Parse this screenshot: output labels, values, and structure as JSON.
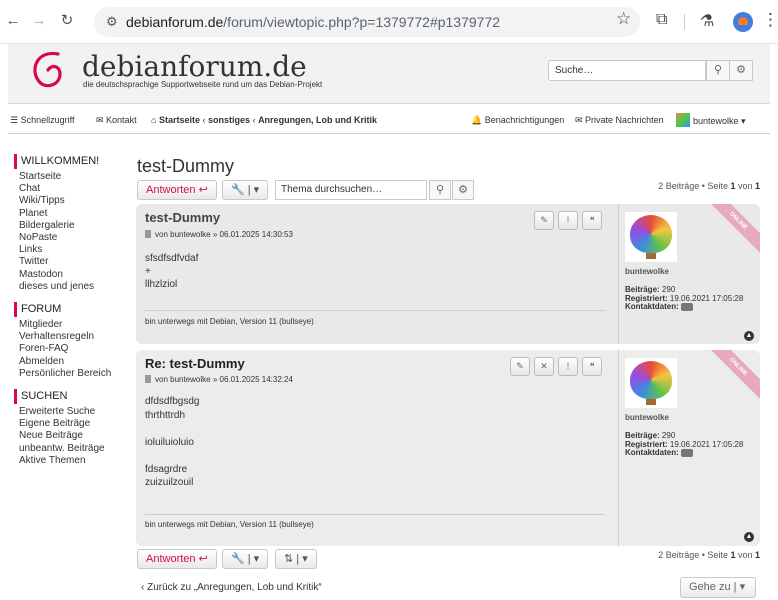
{
  "browser": {
    "url_domain": "debianforum.de",
    "url_path": "/forum/viewtopic.php?p=1379772#p1379772"
  },
  "header": {
    "title": "debianforum.de",
    "subtitle": "die deutschsprachige Supportwebseite rund um das Debian-Projekt",
    "search_placeholder": "Suche…"
  },
  "nav": {
    "quicklinks": "Schnellzugriff",
    "contact": "Kontakt",
    "breadcrumb_home": "Startseite",
    "breadcrumb_sep1": "‹",
    "breadcrumb_cat": "sonstiges",
    "breadcrumb_sep2": "‹",
    "breadcrumb_forum": "Anregungen, Lob und Kritik",
    "notifications": "Benachrichtigungen",
    "private_messages": "Private Nachrichten",
    "user": "buntewolke"
  },
  "sidebar": {
    "welcome": {
      "title": "WILLKOMMEN!",
      "items": [
        "Startseite",
        "Chat",
        "Wiki/Tipps",
        "Planet",
        "Bildergalerie",
        "NoPaste",
        "Links",
        "Twitter",
        "Mastodon",
        "dieses und jenes"
      ]
    },
    "forum": {
      "title": "FORUM",
      "items": [
        "Mitglieder",
        "Verhaltensregeln",
        "Foren-FAQ",
        "Abmelden",
        "Persönlicher Bereich"
      ]
    },
    "search": {
      "title": "SUCHEN",
      "items": [
        "Erweiterte Suche",
        "Eigene Beiträge",
        "Neue Beiträge",
        "unbeantw. Beiträge",
        "Aktive Themen"
      ]
    }
  },
  "topic": {
    "title": "test-Dummy",
    "reply_label": "Antworten",
    "search_placeholder": "Thema durchsuchen…",
    "page_info_prefix": "2 Beiträge • Seite ",
    "page_current": "1",
    "page_mid": " von ",
    "page_total": "1"
  },
  "posts": [
    {
      "title": "test-Dummy",
      "meta": "von buntewolke » 06.01.2025 14:30:53",
      "lines": [
        "sfsdfsdfvdaf",
        "+",
        "llhzlziol"
      ],
      "signature": "bin unterwegs mit Debian, Version 11 (bullseye)",
      "author": "buntewolke",
      "posts_label": "Beiträge:",
      "posts_count": "290",
      "registered_label": "Registriert:",
      "registered": "19.06.2021 17:05:28",
      "contact_label": "Kontaktdaten:",
      "online": "ONLINE"
    },
    {
      "title": "Re: test-Dummy",
      "meta": "von buntewolke » 06.01.2025 14:32:24",
      "lines": [
        "dfdsdfbgsdg",
        "thrthttrdh",
        "",
        "ioluiluioluio",
        "",
        "fdsagrdre",
        "zuizuilzouil"
      ],
      "signature": "bin unterwegs mit Debian, Version 11 (bullseye)",
      "author": "buntewolke",
      "posts_label": "Beiträge:",
      "posts_count": "290",
      "registered_label": "Registriert:",
      "registered": "19.06.2021 17:05:28",
      "contact_label": "Kontaktdaten:",
      "online": "ONLINE"
    }
  ],
  "footer": {
    "back_link": "Zurück zu „Anregungen, Lob und Kritik“",
    "goto": "Gehe zu"
  },
  "colors": {
    "accent": "#d70751",
    "post_bg": "#e9e9e9",
    "online_ribbon": "#e7a9be"
  }
}
